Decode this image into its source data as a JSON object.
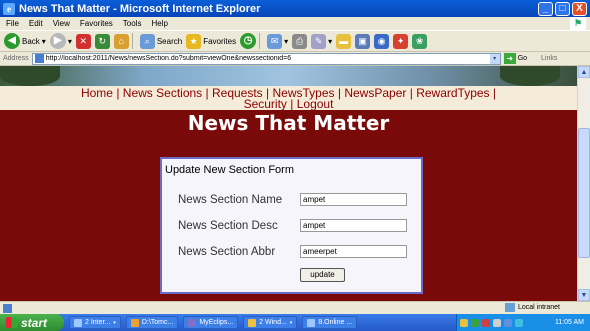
{
  "window": {
    "title": "News That Matter - Microsoft Internet Explorer",
    "minimize": "_",
    "maximize": "□",
    "close": "X"
  },
  "menubar": [
    "File",
    "Edit",
    "View",
    "Favorites",
    "Tools",
    "Help"
  ],
  "toolbar": {
    "back_label": "Back",
    "search_label": "Search",
    "favorites_label": "Favorites"
  },
  "addressbar": {
    "label": "Address",
    "url": "http://localhost:2011/News/newsSection.do?submit=viewOne&newssectionid=6",
    "go_label": "Go",
    "links_label": "Links"
  },
  "page": {
    "nav_row1": [
      "Home",
      "|",
      "News Sections",
      "|",
      "Requests",
      "|",
      "NewsTypes",
      "|",
      "NewsPaper",
      "|",
      "RewardTypes",
      "|"
    ],
    "nav_row2": [
      "Security",
      "|",
      "Logout"
    ],
    "headline": "News That Matter",
    "form": {
      "title": "Update New Section Form",
      "fields": [
        {
          "label": "News Section Name",
          "value": "ampet"
        },
        {
          "label": "News Section Desc",
          "value": "ampet"
        },
        {
          "label": "News Section Abbr",
          "value": "ameerpet"
        }
      ],
      "submit_label": "update"
    }
  },
  "statusbar": {
    "zone": "Local intranet"
  },
  "taskbar": {
    "start_label": "start",
    "tasks": [
      "2 Inter...",
      "D:\\Tomc...",
      "MyEclips...",
      "2 Wind...",
      "8.Online ..."
    ],
    "clock": "11:05 AM"
  },
  "colors": {
    "page_background": "#7a0a0a",
    "nav_text": "#8b0000",
    "form_border": "#6b6bc8"
  }
}
